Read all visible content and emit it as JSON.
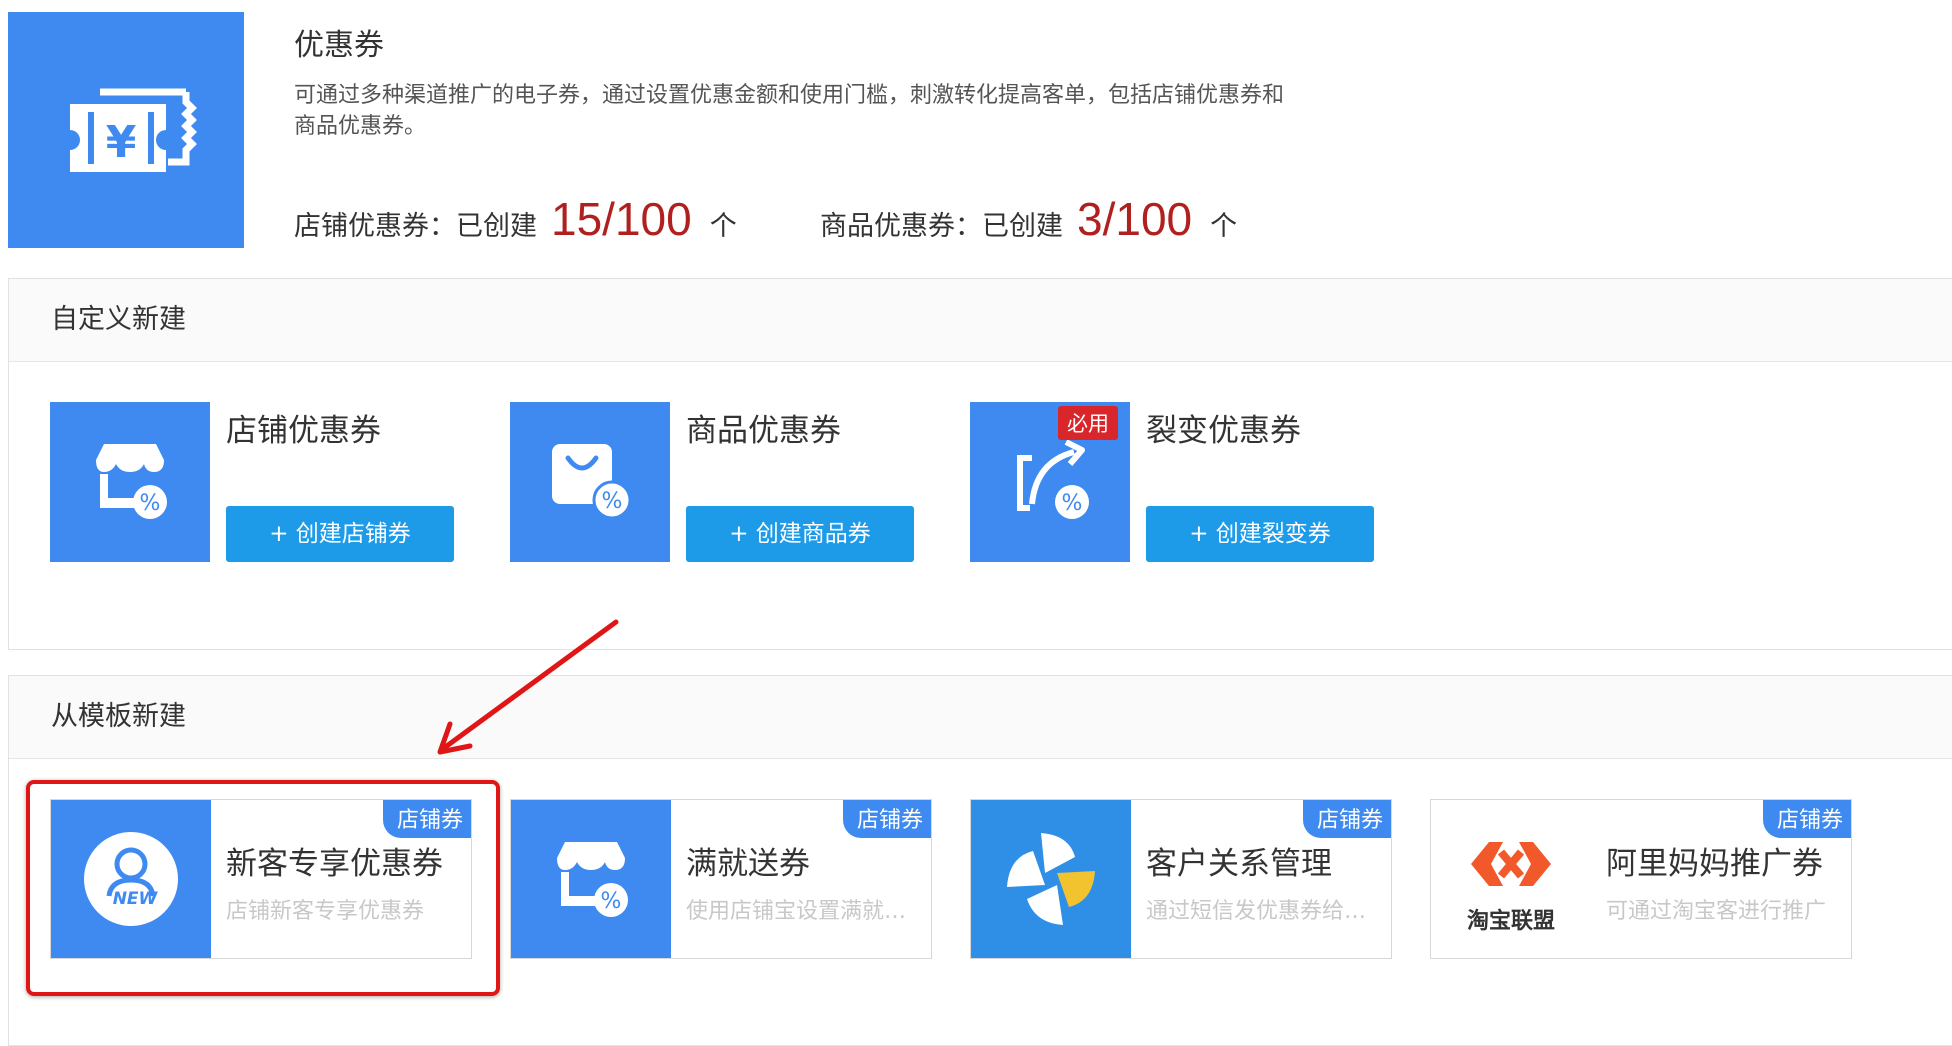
{
  "header": {
    "title": "优惠券",
    "description": "可通过多种渠道推广的电子券，通过设置优惠金额和使用门槛，刺激转化提高客单，包括店铺优惠券和商品优惠券。",
    "stats": [
      {
        "label": "店铺优惠券：已创建",
        "value": "15/100",
        "unit": "个"
      },
      {
        "label": "商品优惠券：已创建",
        "value": "3/100",
        "unit": "个"
      }
    ]
  },
  "custom": {
    "title": "自定义新建",
    "cards": [
      {
        "title": "店铺优惠券",
        "button": "+ 创建店铺券",
        "icon": "store-discount-icon"
      },
      {
        "title": "商品优惠券",
        "button": "+ 创建商品券",
        "icon": "bag-discount-icon"
      },
      {
        "title": "裂变优惠券",
        "button": "+ 创建裂变券",
        "icon": "share-discount-icon",
        "badge": "必用"
      }
    ]
  },
  "templates": {
    "title": "从模板新建",
    "cards": [
      {
        "title": "新客专享优惠券",
        "subtitle": "店铺新客专享优惠券",
        "badge": "店铺券",
        "icon": "new-user-icon",
        "icon_text": "NEW"
      },
      {
        "title": "满就送券",
        "subtitle": "使用店铺宝设置满就送优惠券",
        "badge": "店铺券",
        "icon": "store-discount-icon"
      },
      {
        "title": "客户关系管理",
        "subtitle": "通过短信发优惠券给客户",
        "badge": "店铺券",
        "icon": "pinwheel-icon"
      },
      {
        "title": "阿里妈妈推广券",
        "subtitle": "可通过淘宝客进行推广",
        "badge": "店铺券",
        "icon": "taobao-union-logo",
        "logo_text": "淘宝联盟"
      }
    ]
  },
  "colors": {
    "accent": "#3e8af0",
    "button": "#1e9be8",
    "stat": "#b0201e",
    "highlight": "#e01515"
  }
}
